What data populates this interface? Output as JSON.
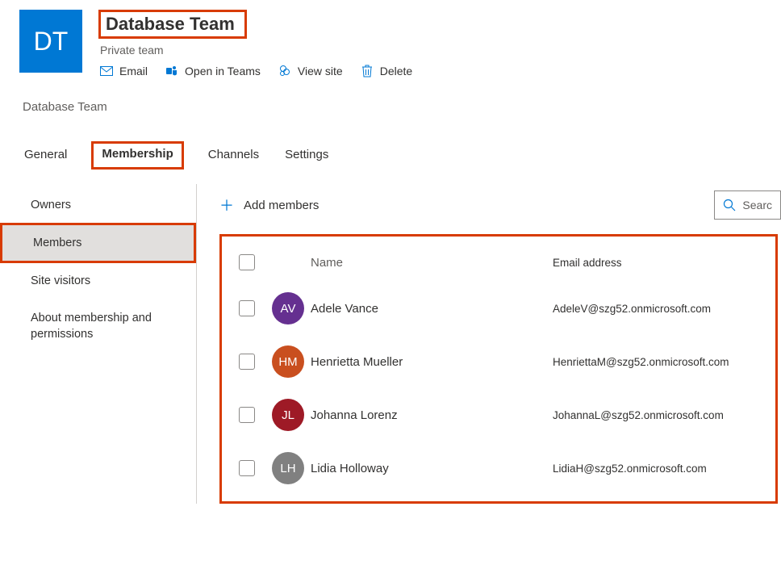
{
  "team": {
    "tileInitials": "DT",
    "name": "Database Team",
    "visibility": "Private team"
  },
  "actions": {
    "email": "Email",
    "openInTeams": "Open in Teams",
    "viewSite": "View site",
    "delete": "Delete"
  },
  "breadcrumb": "Database Team",
  "tabs": {
    "general": "General",
    "membership": "Membership",
    "channels": "Channels",
    "settings": "Settings"
  },
  "sidebar": {
    "owners": "Owners",
    "members": "Members",
    "siteVisitors": "Site visitors",
    "about": "About membership and permissions"
  },
  "main": {
    "addMembers": "Add members",
    "searchPlaceholder": "Searc",
    "columns": {
      "name": "Name",
      "email": "Email address"
    },
    "members": [
      {
        "initials": "AV",
        "color": "#653090",
        "name": "Adele Vance",
        "email": "AdeleV@szg52.onmicrosoft.com"
      },
      {
        "initials": "HM",
        "color": "#c94f1f",
        "name": "Henrietta Mueller",
        "email": "HenriettaM@szg52.onmicrosoft.com"
      },
      {
        "initials": "JL",
        "color": "#9e1a26",
        "name": "Johanna Lorenz",
        "email": "JohannaL@szg52.onmicrosoft.com"
      },
      {
        "initials": "LH",
        "color": "#808080",
        "name": "Lidia Holloway",
        "email": "LidiaH@szg52.onmicrosoft.com"
      }
    ]
  }
}
